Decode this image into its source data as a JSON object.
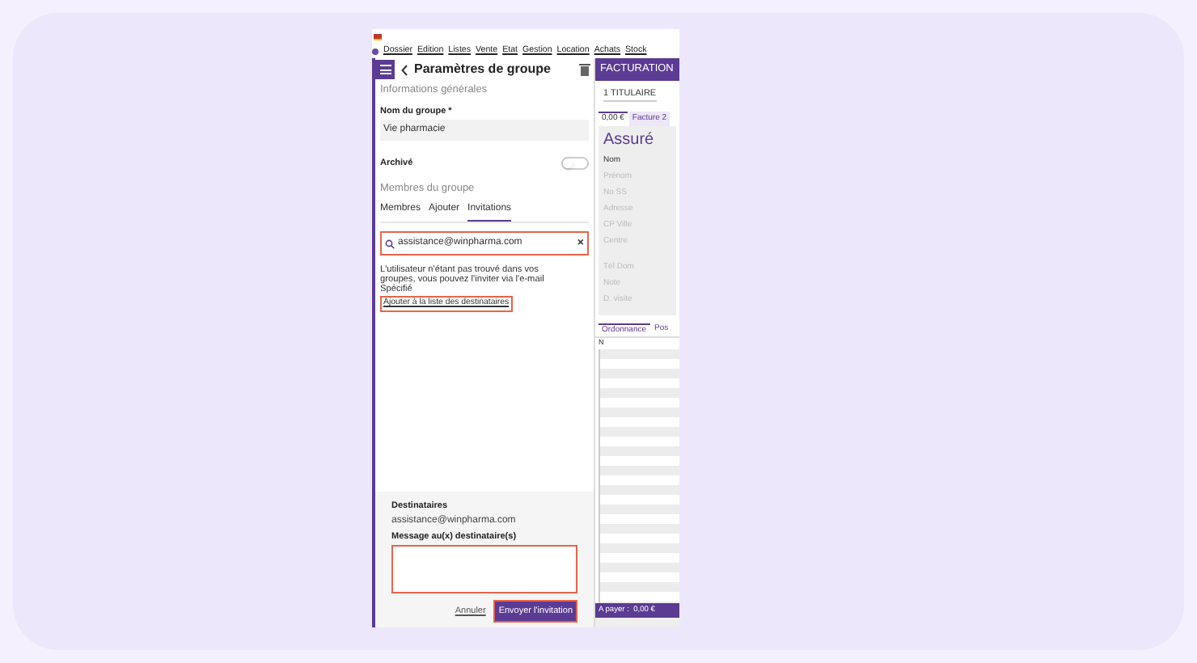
{
  "menu_bar": {
    "items": [
      "Dossier",
      "Edition",
      "Listes",
      "Vente",
      "Etat",
      "Gestion",
      "Location",
      "Achats",
      "Stock"
    ]
  },
  "group_panel": {
    "title": "Paramètres de groupe",
    "section_general": "Informations générales",
    "name_label": "Nom du groupe *",
    "name_value": "Vie pharmacie",
    "archived_label": "Archivé",
    "archived": false,
    "section_members": "Membres du groupe",
    "tabs": [
      {
        "label": "Membres",
        "selected": false
      },
      {
        "label": "Ajouter",
        "selected": false
      },
      {
        "label": "Invitations",
        "selected": true
      }
    ],
    "search_value": "assistance@winpharma.com",
    "clear_symbol": "×",
    "message": "L'utilisateur n'étant pas trouvé dans vos groupes, vous pouvez l'inviter via l'e-mail Spécifié",
    "add_link": "Ajouter à la liste des destinataires",
    "recipients_label": "Destinataires",
    "recipient": "assistance@winpharma.com",
    "message_label": "Message au(x) destinataire(s)",
    "cancel": "Annuler",
    "send": "Envoyer l'invitation"
  },
  "billing": {
    "title": "FACTURATION",
    "holder": "1 TITULAIRE",
    "tabs": [
      {
        "label": "0,00 €",
        "selected": true
      },
      {
        "label": "Facture 2",
        "selected": false
      }
    ],
    "insured_title": "Assuré",
    "fields": [
      {
        "label": "Nom",
        "disabled": false
      },
      {
        "label": "Prénom",
        "disabled": true
      },
      {
        "label": "No SS",
        "disabled": true
      },
      {
        "label": "Adresse",
        "disabled": true
      },
      {
        "label": "CP Ville",
        "disabled": true
      },
      {
        "label": "Centre",
        "disabled": true
      },
      {
        "label": "Tél Dom",
        "disabled": true
      },
      {
        "label": "Note",
        "disabled": true
      },
      {
        "label": "D. visite",
        "disabled": true
      }
    ],
    "lower_tabs": [
      {
        "label": "Ordonnance",
        "selected": true
      },
      {
        "label": "Pos",
        "selected": false
      }
    ],
    "column_1": "N",
    "total": "A payer :  0,00 €"
  }
}
